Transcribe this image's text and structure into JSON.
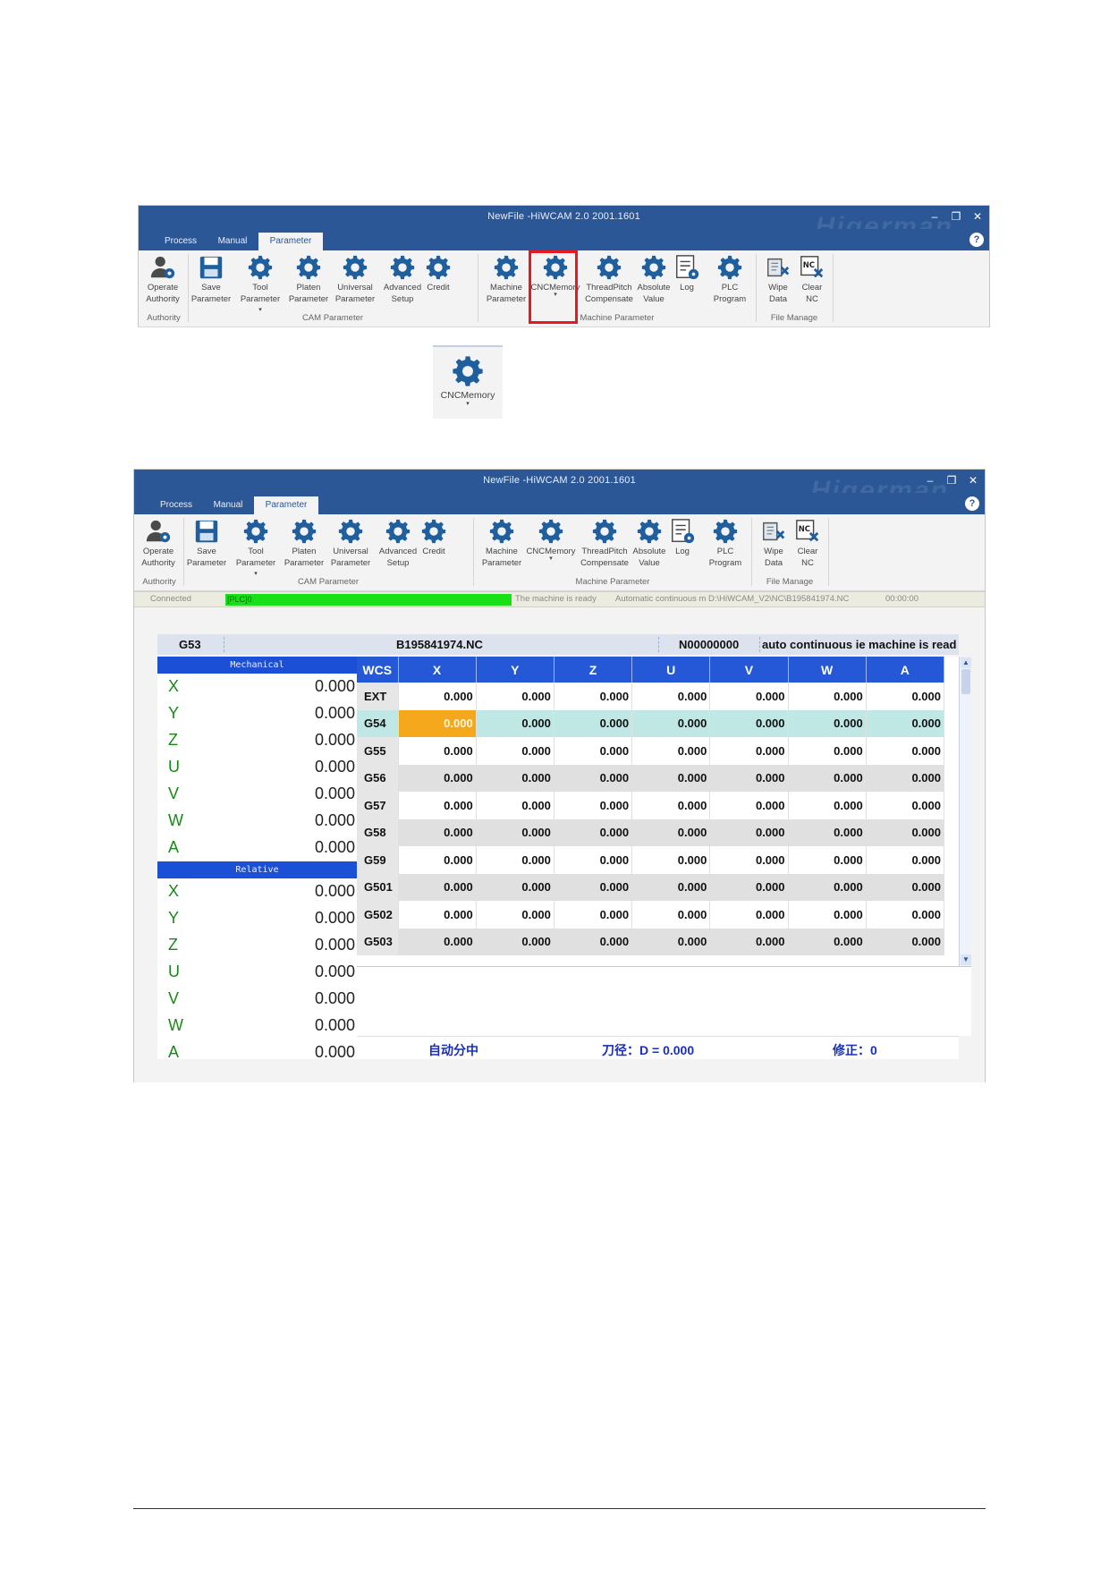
{
  "window": {
    "title": "NewFile -HiWCAM 2.0 2001.1601",
    "watermark": "Higerman",
    "controls": {
      "minimize": "–",
      "restore": "❐",
      "close": "✕"
    },
    "help": "?"
  },
  "tabs": [
    "Process",
    "Manual",
    "Parameter"
  ],
  "active_tab": "Parameter",
  "ribbon": {
    "buttons": [
      {
        "label1": "Operate",
        "label2": "Authority",
        "icon": "user-gear-icon"
      },
      {
        "label1": "Save",
        "label2": "Parameter",
        "icon": "save-icon"
      },
      {
        "label1": "Tool",
        "label2": "Parameter",
        "icon": "gear-icon",
        "caret": "▾"
      },
      {
        "label1": "Platen",
        "label2": "Parameter",
        "icon": "gear-icon"
      },
      {
        "label1": "Universal",
        "label2": "Parameter",
        "icon": "gear-icon"
      },
      {
        "label1": "Advanced",
        "label2": "Setup",
        "icon": "gear-icon"
      },
      {
        "label1": "Credit",
        "label2": "",
        "icon": "gear-icon"
      },
      {
        "label1": "Machine",
        "label2": "Parameter",
        "icon": "gear-icon"
      },
      {
        "label1": "CNCMemory",
        "label2": "",
        "icon": "gear-icon",
        "caret": "▾"
      },
      {
        "label1": "ThreadPitch",
        "label2": "Compensate",
        "icon": "gear-icon"
      },
      {
        "label1": "Absolute",
        "label2": "Value",
        "icon": "gear-icon"
      },
      {
        "label1": "Log",
        "label2": "",
        "icon": "log-icon"
      },
      {
        "label1": "PLC",
        "label2": "Program",
        "icon": "gear-icon"
      },
      {
        "label1": "Wipe",
        "label2": "Data",
        "icon": "wipe-data-icon"
      },
      {
        "label1": "Clear",
        "label2": "NC",
        "icon": "clear-nc-icon"
      }
    ],
    "groups": [
      "Authority",
      "CAM Parameter",
      "Machine Parameter",
      "File Manage"
    ]
  },
  "zoom_icon": {
    "label": "CNCMemory",
    "caret": "▾"
  },
  "status": {
    "connection": "Connected",
    "plc": "[PLC]0",
    "ready": "The machine is ready",
    "mode_path": "Automatic continuous m D:\\HiWCAM_V2\\NC\\B195841974.NC",
    "timer": "00:00:00"
  },
  "info": {
    "wcs": "G53",
    "file": "B195841974.NC",
    "line": "N00000000",
    "message": "auto continuous ie machine is read"
  },
  "mechanical": {
    "header": "Mechanical",
    "rows": [
      {
        "axis": "X",
        "value": "0.000"
      },
      {
        "axis": "Y",
        "value": "0.000"
      },
      {
        "axis": "Z",
        "value": "0.000"
      },
      {
        "axis": "U",
        "value": "0.000"
      },
      {
        "axis": "V",
        "value": "0.000"
      },
      {
        "axis": "W",
        "value": "0.000"
      },
      {
        "axis": "A",
        "value": "0.000"
      }
    ]
  },
  "relative": {
    "header": "Relative",
    "rows": [
      {
        "axis": "X",
        "value": "0.000"
      },
      {
        "axis": "Y",
        "value": "0.000"
      },
      {
        "axis": "Z",
        "value": "0.000"
      },
      {
        "axis": "U",
        "value": "0.000"
      },
      {
        "axis": "V",
        "value": "0.000"
      },
      {
        "axis": "W",
        "value": "0.000"
      },
      {
        "axis": "A",
        "value": "0.000"
      }
    ]
  },
  "wcs_table": {
    "columns": [
      "WCS",
      "X",
      "Y",
      "Z",
      "U",
      "V",
      "W",
      "A"
    ],
    "rows": [
      [
        "EXT",
        "0.000",
        "0.000",
        "0.000",
        "0.000",
        "0.000",
        "0.000",
        "0.000"
      ],
      [
        "G54",
        "0.000",
        "0.000",
        "0.000",
        "0.000",
        "0.000",
        "0.000",
        "0.000"
      ],
      [
        "G55",
        "0.000",
        "0.000",
        "0.000",
        "0.000",
        "0.000",
        "0.000",
        "0.000"
      ],
      [
        "G56",
        "0.000",
        "0.000",
        "0.000",
        "0.000",
        "0.000",
        "0.000",
        "0.000"
      ],
      [
        "G57",
        "0.000",
        "0.000",
        "0.000",
        "0.000",
        "0.000",
        "0.000",
        "0.000"
      ],
      [
        "G58",
        "0.000",
        "0.000",
        "0.000",
        "0.000",
        "0.000",
        "0.000",
        "0.000"
      ],
      [
        "G59",
        "0.000",
        "0.000",
        "0.000",
        "0.000",
        "0.000",
        "0.000",
        "0.000"
      ],
      [
        "G501",
        "0.000",
        "0.000",
        "0.000",
        "0.000",
        "0.000",
        "0.000",
        "0.000"
      ],
      [
        "G502",
        "0.000",
        "0.000",
        "0.000",
        "0.000",
        "0.000",
        "0.000",
        "0.000"
      ],
      [
        "G503",
        "0.000",
        "0.000",
        "0.000",
        "0.000",
        "0.000",
        "0.000",
        "0.000"
      ]
    ],
    "selected_row": "G54"
  },
  "footer": {
    "mode": "自动分中",
    "diameter": "刀径：D = 0.000",
    "correction": "修正：0"
  },
  "colors": {
    "titlebar": "#2b5797",
    "header_blue": "#2458d6",
    "selected_row": "#bfe8e4",
    "current_cell": "#f5a81c",
    "plc_bar": "#17e017",
    "axis_green": "#158a15",
    "highlight_red": "#e8181e"
  }
}
